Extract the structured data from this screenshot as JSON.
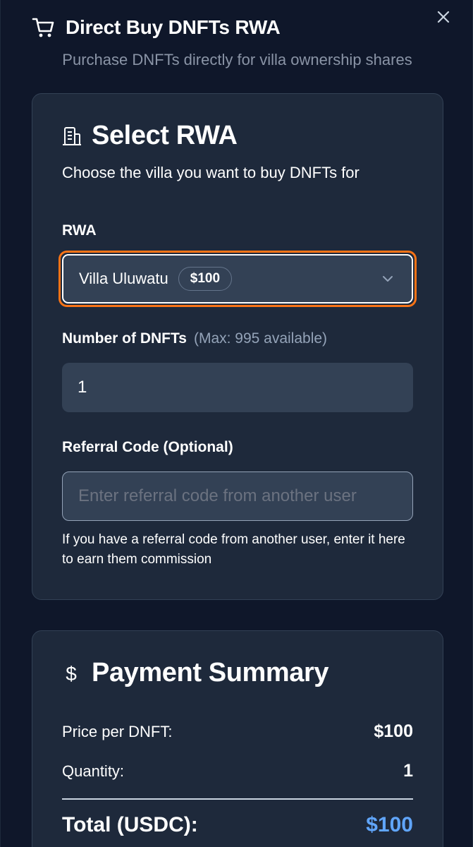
{
  "header": {
    "title": "Direct Buy DNFTs RWA",
    "subtitle": "Purchase DNFTs directly for villa ownership shares"
  },
  "select_card": {
    "title": "Select RWA",
    "description": "Choose the villa you want to buy DNFTs for",
    "rwa_label": "RWA",
    "rwa_value": "Villa Uluwatu",
    "rwa_price": "$100",
    "quantity_label": "Number of DNFTs",
    "quantity_hint": "(Max: 995 available)",
    "quantity_value": "1",
    "referral_label": "Referral Code (Optional)",
    "referral_placeholder": "Enter referral code from another user",
    "referral_help": "If you have a referral code from another user, enter it here to earn them commission"
  },
  "payment_card": {
    "title": "Payment Summary",
    "price_label": "Price per DNFT:",
    "price_value": "$100",
    "quantity_label": "Quantity:",
    "quantity_value": "1",
    "total_label": "Total (USDC):",
    "total_value": "$100"
  },
  "icons": {
    "close": "close-icon",
    "cart": "shopping-cart-icon",
    "building": "building-icon",
    "chevron": "chevron-down-icon",
    "dollar": "dollar-icon"
  },
  "colors": {
    "background": "#0f172a",
    "card": "#1e293b",
    "input": "#334155",
    "focus_ring": "#f97316",
    "total_accent": "#60a5fa"
  }
}
